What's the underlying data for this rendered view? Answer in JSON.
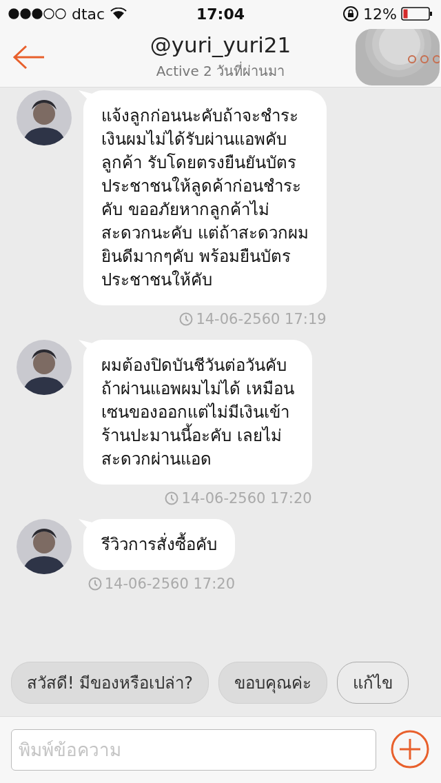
{
  "status_bar": {
    "carrier": "dtac",
    "time": "17:04",
    "battery": "12%"
  },
  "header": {
    "title": "@yuri_yuri21",
    "subtitle": "Active 2 วันที่ผ่านมา"
  },
  "messages": [
    {
      "text": "แจ้งลูกก่อนนะคับถ้าจะชำระ\nเงินผมไม่ได้รับผ่านแอพคับ\nลูกค้า รับโดยตรงยืนยันบัตร\nประชาชนให้ลูดค้าก่อนชำระ\nคับ ขออภัยหากลูกค้าไม่\nสะดวกนะคับ แต่ถ้าสะดวกผม\nยินดีมากๆคับ พร้อมยืนบัตร\nประชาชนให้คับ",
      "time": "14-06-2560 17:19"
    },
    {
      "text": "ผมต้องปิดบันชีวันต่อวันคับ\nถ้าผ่านแอพผมไม่ได้ เหมือน\nเซนของออกแต่ไม่มีเงินเข้า\nร้านปะมานนี้อะคับ เลยไม่\nสะดวกผ่านแอด",
      "time": "14-06-2560 17:20"
    },
    {
      "text": "รีวิวการสั่งซื้อคับ",
      "time": "14-06-2560 17:20"
    }
  ],
  "quick_replies": [
    {
      "kind": "suggestion",
      "label": "สวัสดี! มีของหรือเปล่า?"
    },
    {
      "kind": "suggestion",
      "label": "ขอบคุณค่ะ"
    },
    {
      "kind": "edit",
      "label": "แก้ไข"
    }
  ],
  "composer": {
    "placeholder": "พิมพ์ข้อความ"
  }
}
